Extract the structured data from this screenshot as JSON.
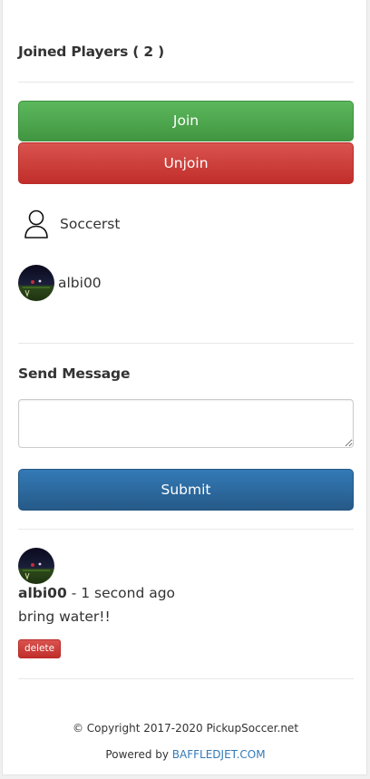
{
  "players_section": {
    "heading": "Joined Players ( 2 )",
    "join_label": "Join",
    "unjoin_label": "Unjoin",
    "players": [
      {
        "name": "Soccerst",
        "avatar": "user-outline-icon"
      },
      {
        "name": "albi00",
        "avatar": "soccer-field-night-photo"
      }
    ]
  },
  "message_section": {
    "heading": "Send Message",
    "textarea_value": "",
    "submit_label": "Submit"
  },
  "messages": [
    {
      "user": "albi00",
      "separator": " - ",
      "time": "1 second ago",
      "text": "bring water!!",
      "delete_label": "delete"
    }
  ],
  "footer": {
    "copyright": "© Copyright 2017-2020 PickupSoccer.net",
    "powered_prefix": "Powered by ",
    "powered_link": "BAFFLEDJET.COM"
  },
  "colors": {
    "join": "#5cb85c",
    "unjoin": "#d9534f",
    "submit": "#337ab7",
    "link": "#337ab7"
  }
}
